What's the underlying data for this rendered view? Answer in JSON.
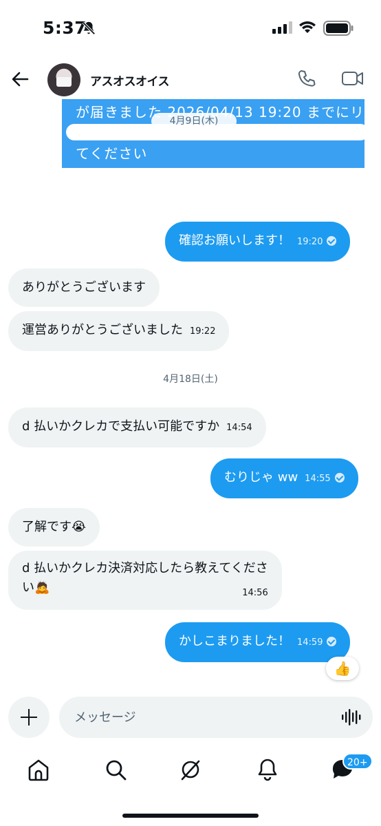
{
  "status_bar": {
    "time": "5:37"
  },
  "header": {
    "contact_name": "アスオスオイス"
  },
  "image_message": {
    "line1": "が届きました 2026/04/13 19:20 までにリ",
    "line2": "てください",
    "overlay_date": "4月9日(木)"
  },
  "messages": [
    {
      "text": "確認お願いします！",
      "time": "19:20"
    },
    {
      "text": "ありがとうございます"
    },
    {
      "text": "運営ありがとうございました",
      "time": "19:22"
    },
    {
      "text": "d 払いかクレカで支払い可能ですか",
      "time": "14:54"
    },
    {
      "text": "むりじゃ ww",
      "time": "14:55"
    },
    {
      "text": "了解です😭"
    },
    {
      "text_line1": "d 払いかクレカ決済対応したら教えてくださ",
      "text_line2": "い🙇",
      "time": "14:56"
    },
    {
      "text": "かしこまりました！",
      "time": "14:59",
      "reaction": "👍"
    }
  ],
  "date_separator": "4月18日(土)",
  "composer": {
    "placeholder": "メッセージ"
  },
  "nav": {
    "badge": "20+"
  },
  "colors": {
    "accent": "#1d9bf0",
    "received_bubble": "#eff3f4"
  }
}
